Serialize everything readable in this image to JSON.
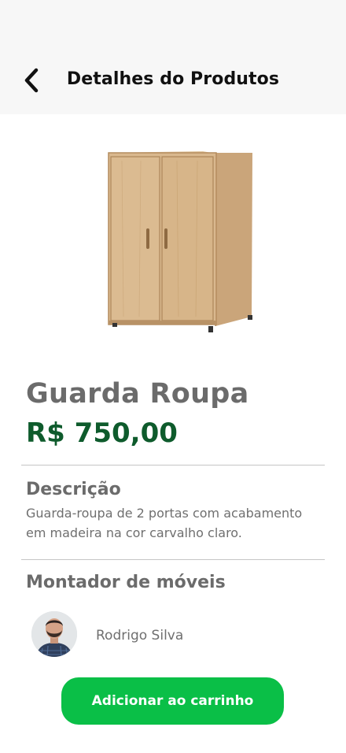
{
  "header": {
    "title": "Detalhes do Produtos",
    "back_icon": "chevron-left-icon"
  },
  "product": {
    "name": "Guarda Roupa",
    "price": "R$ 750,00",
    "image": "wardrobe-image"
  },
  "description": {
    "title": "Descrição",
    "text": "Guarda-roupa de 2 portas com acabamento em madeira na cor carvalho claro."
  },
  "assembler": {
    "title": "Montador de móveis",
    "name": "Rodrigo Silva",
    "avatar": "avatar-photo"
  },
  "actions": {
    "add_to_cart_label": "Adicionar ao carrinho"
  },
  "colors": {
    "price": "#0e5b2c",
    "button": "#0abf47",
    "header_bg": "#f7f7f7"
  }
}
